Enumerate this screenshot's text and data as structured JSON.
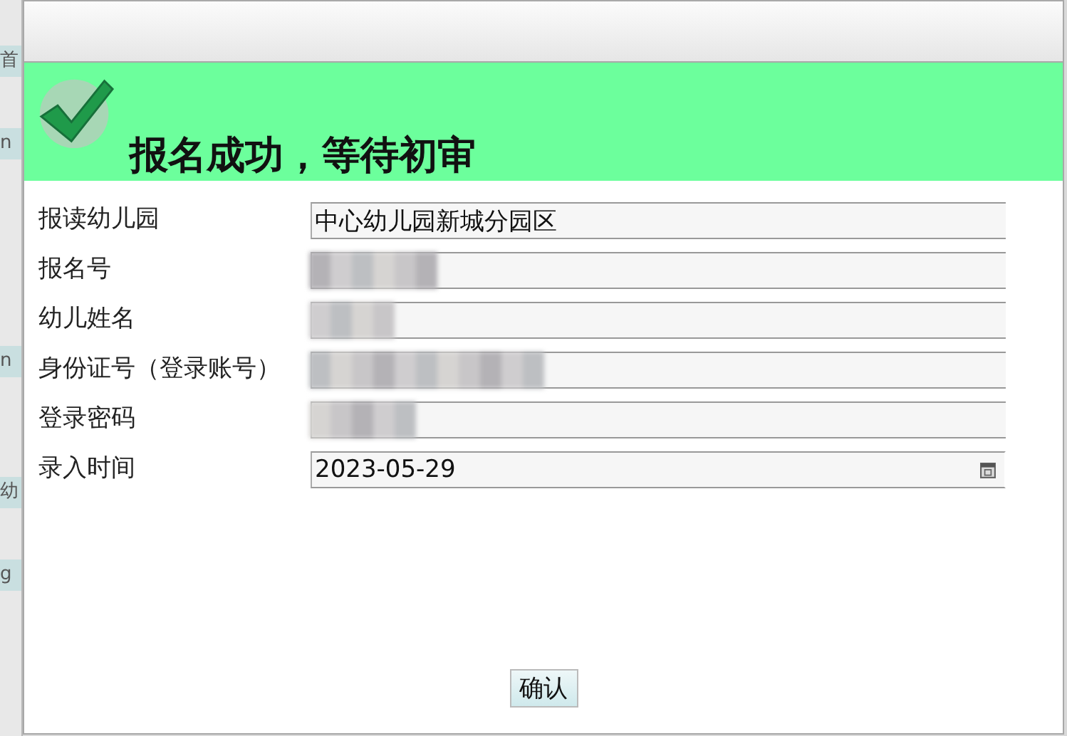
{
  "background_tabs": [
    "首",
    "n",
    "n",
    "幼",
    "g"
  ],
  "dialog": {
    "heading": "报名成功，等待初审",
    "fields": [
      {
        "label": "报读幼儿园",
        "kind": "text",
        "value": "中心幼儿园新城分园区"
      },
      {
        "label": "报名号",
        "kind": "redacted"
      },
      {
        "label": "幼儿姓名",
        "kind": "redacted"
      },
      {
        "label": "身份证号（登录账号）",
        "kind": "redacted"
      },
      {
        "label": "登录密码",
        "kind": "redacted"
      },
      {
        "label": "录入时间",
        "kind": "date",
        "value": "2023-05-29"
      }
    ],
    "button": "确认"
  }
}
